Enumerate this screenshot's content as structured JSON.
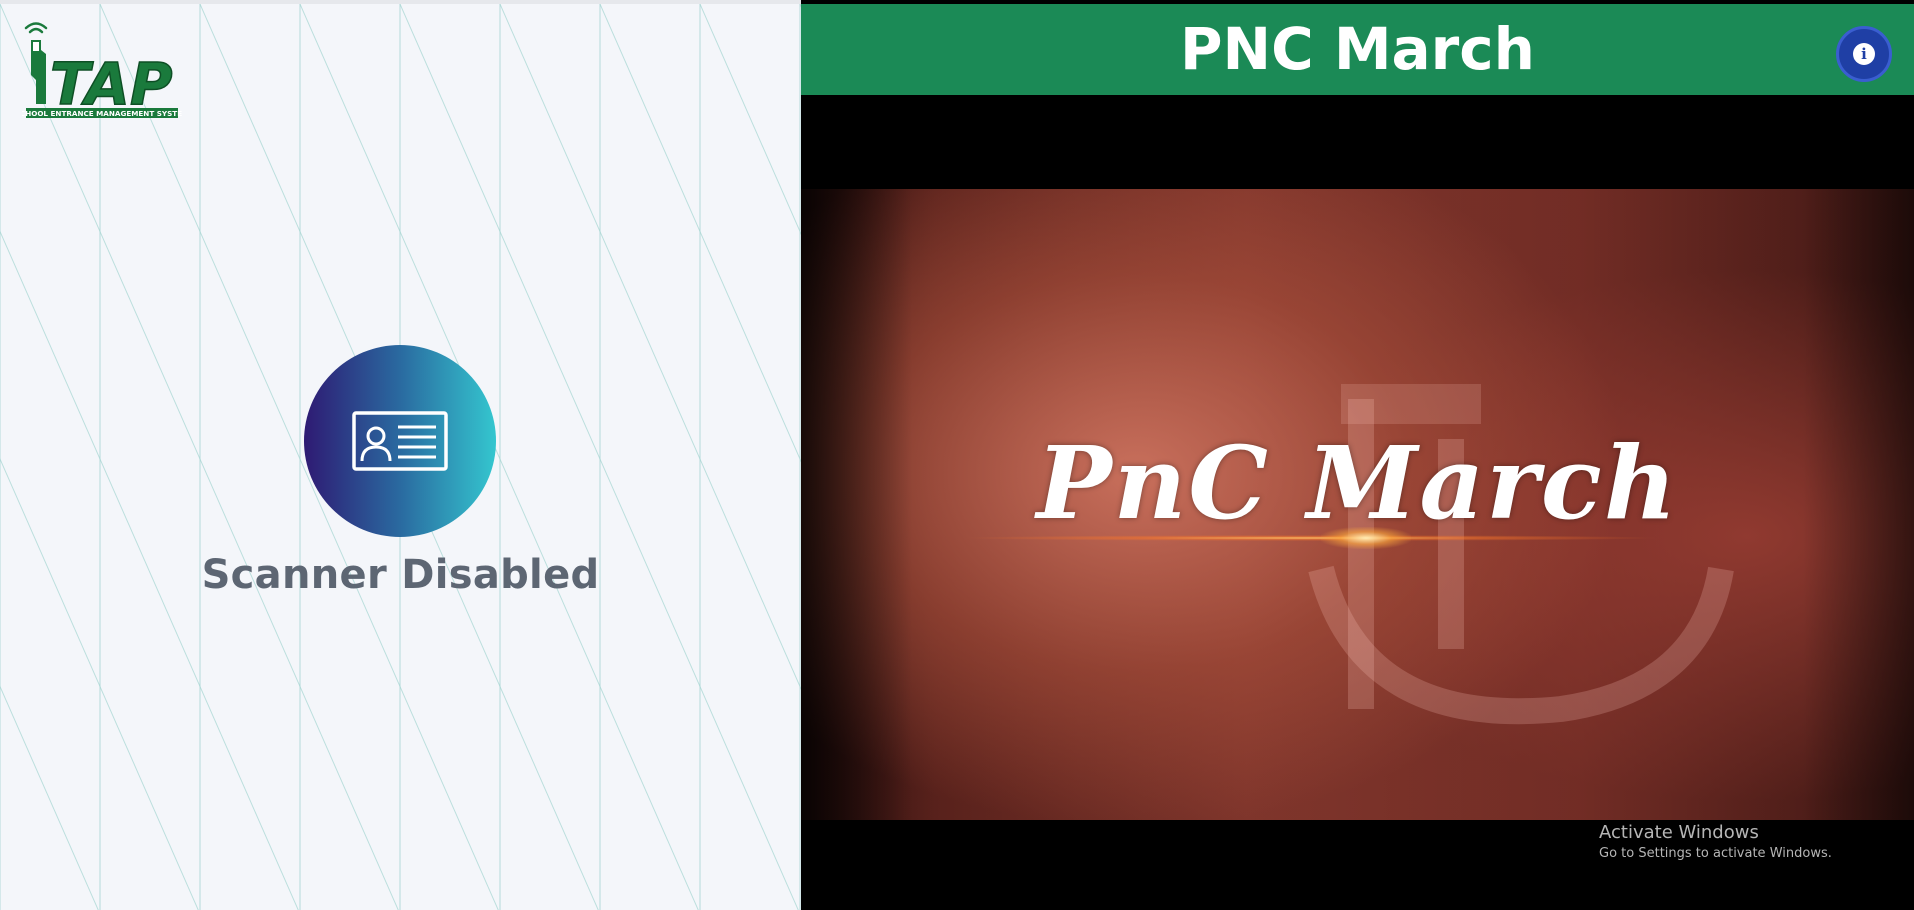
{
  "logo": {
    "brand": "TAP",
    "tagline": "SCHOOL ENTRANCE MANAGEMENT SYSTEM"
  },
  "scanner": {
    "icon": "id-card-icon",
    "status": "Scanner Disabled"
  },
  "header": {
    "title": "PNC March",
    "info_icon": "info-icon"
  },
  "video": {
    "title": "PnC March"
  },
  "watermark": {
    "title": "Activate Windows",
    "subtitle": "Go to Settings to activate Windows."
  },
  "colors": {
    "header_bg": "#1b8a56",
    "info_button": "#1f3fa5",
    "scanner_gradient_start": "#2e1a73",
    "scanner_gradient_end": "#34c6cf",
    "scanner_text": "#5d6673",
    "logo_green": "#1a7a3c"
  }
}
